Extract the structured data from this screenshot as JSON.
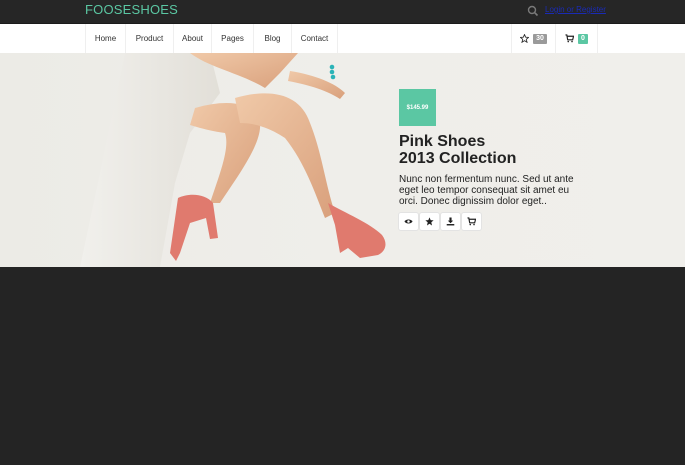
{
  "header": {
    "brand": "FOOSESHOES",
    "login_text": "Login or Register"
  },
  "nav": {
    "items": [
      "Home",
      "Product",
      "About",
      "Pages",
      "Blog",
      "Contact"
    ],
    "wishlist_count": "30",
    "cart_count": "0"
  },
  "hero": {
    "price": "$145.99",
    "title_line1": "Pink Shoes",
    "title_line2": "2013 Collection",
    "description": "Nunc non fermentum nunc. Sed ut ante eget leo tempor consequat sit amet eu orci. Donec dignissim dolor eget..",
    "actions": [
      "eye-icon",
      "star-icon",
      "download-icon",
      "cart-icon"
    ]
  },
  "colors": {
    "accent": "#5bc7a3",
    "topbar": "#262626",
    "page_bg": "#242424"
  }
}
